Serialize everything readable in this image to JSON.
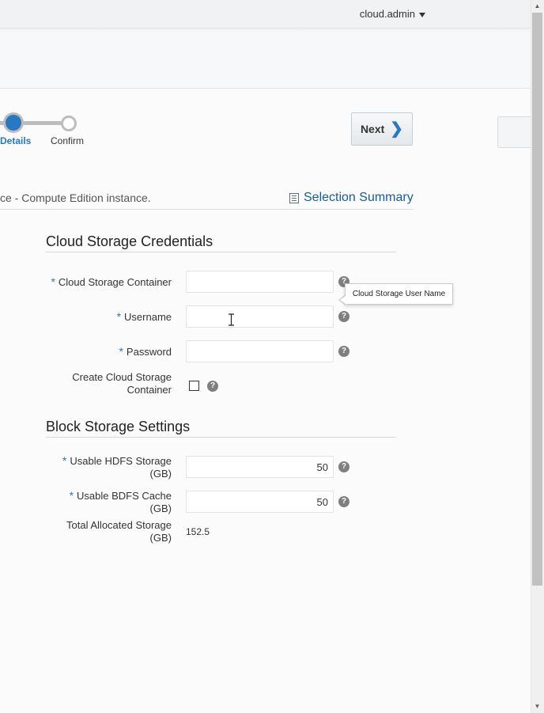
{
  "header": {
    "user": "cloud.admin"
  },
  "train": {
    "steps": [
      {
        "label": "Details",
        "state": "current"
      },
      {
        "label": "Confirm",
        "state": "upcoming"
      }
    ],
    "next_label": "Next"
  },
  "description": "ce - Compute Edition instance.",
  "selection_summary": {
    "label": "Selection Summary",
    "icon": "checklist-icon"
  },
  "credentials": {
    "title": "Cloud Storage Credentials",
    "container": {
      "label": "Cloud Storage Container",
      "value": "",
      "required": true
    },
    "username": {
      "label": "Username",
      "value": "",
      "required": true
    },
    "password": {
      "label": "Password",
      "value": "",
      "required": true
    },
    "create_container": {
      "label_line1": "Create Cloud Storage",
      "label_line2": "Container",
      "checked": false
    },
    "tooltip": "Cloud Storage User Name"
  },
  "block_storage": {
    "title": "Block Storage Settings",
    "hdfs": {
      "label_line1": "Usable HDFS Storage",
      "label_line2": "(GB)",
      "value": "50",
      "required": true
    },
    "bdfs": {
      "label_line1": "Usable BDFS Cache",
      "label_line2": "(GB)",
      "value": "50",
      "required": true
    },
    "total": {
      "label_line1": "Total Allocated Storage",
      "label_line2": "(GB)",
      "value": "152.5"
    }
  },
  "help_glyph": "?",
  "required_marker": "*",
  "colors": {
    "accent": "#2878c2",
    "link": "#145c9e"
  }
}
